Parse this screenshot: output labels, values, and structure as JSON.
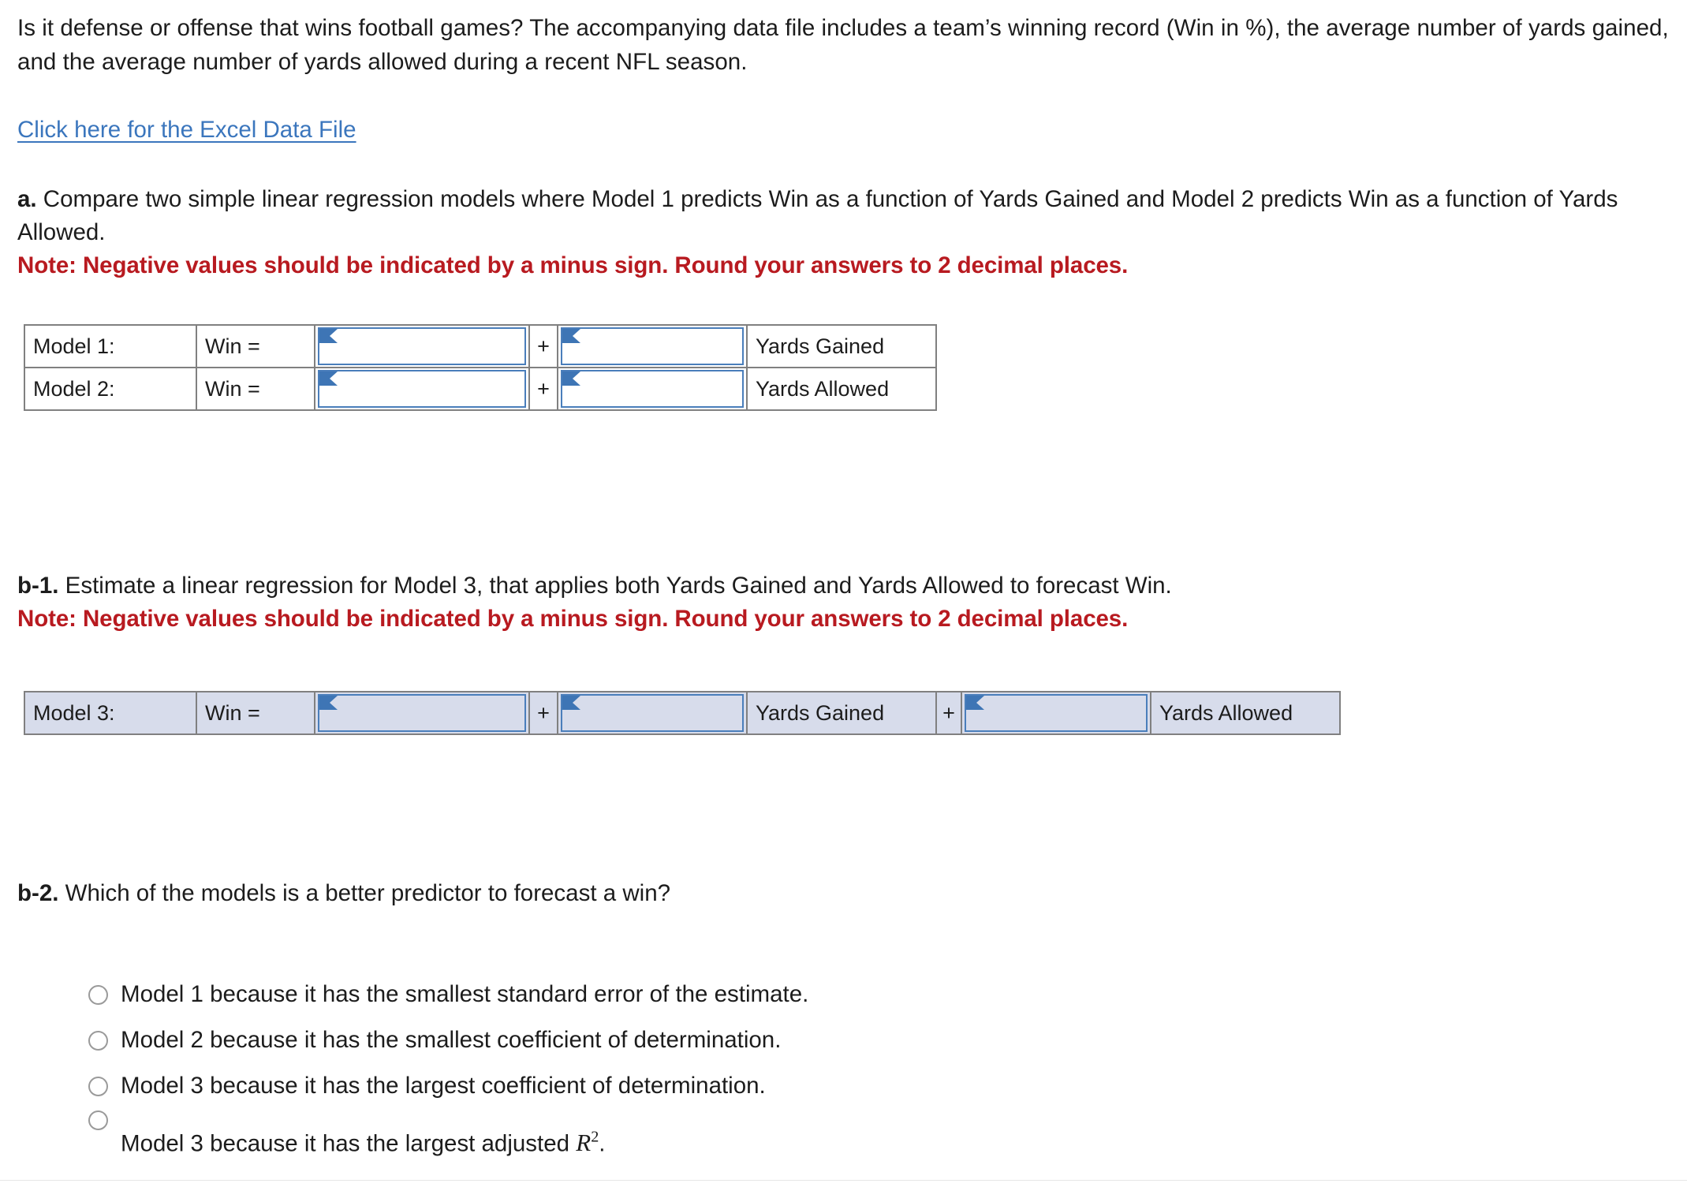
{
  "intro": {
    "paragraph": "Is it defense or offense that wins football games? The accompanying data file includes a team’s winning record (Win in %), the average number of yards gained, and the average number of yards allowed during a recent NFL season."
  },
  "link": {
    "label": "Click here for the Excel Data File"
  },
  "questions": {
    "a": {
      "label": "a.",
      "text": " Compare two simple linear regression models where Model 1 predicts Win as a function of Yards Gained and Model 2 predicts Win as a function of Yards Allowed.",
      "note": "Note: Negative values should be indicated by a minus sign. Round your answers to 2 decimal places."
    },
    "b1": {
      "label": "b-1.",
      "text": " Estimate a linear regression for Model 3, that applies both Yards Gained and Yards Allowed to forecast Win.",
      "note": "Note: Negative values should be indicated by a minus sign. Round your answers to 2 decimal places."
    },
    "b2": {
      "label": "b-2.",
      "text": " Which of the models is a better predictor to forecast a win?"
    }
  },
  "table_a": {
    "rows": [
      {
        "model": "Model 1:",
        "equals": "Win =",
        "intercept_value": "",
        "plus": "+",
        "slope_value": "",
        "variable": "Yards Gained"
      },
      {
        "model": "Model 2:",
        "equals": "Win =",
        "intercept_value": "",
        "plus": "+",
        "slope_value": "",
        "variable": "Yards Allowed"
      }
    ]
  },
  "table_b": {
    "row": {
      "model": "Model 3:",
      "equals": "Win =",
      "intercept_value": "",
      "plus1": "+",
      "slope1_value": "",
      "variable1": "Yards Gained",
      "plus2": "+",
      "slope2_value": "",
      "variable2": "Yards Allowed"
    }
  },
  "options": [
    {
      "text": "Model 1 because it has the smallest standard error of the estimate.",
      "selected": false
    },
    {
      "text": "Model 2 because it has the smallest coefficient of determination.",
      "selected": false
    },
    {
      "text": "Model 3 because it has the largest coefficient of determination.",
      "selected": false
    },
    {
      "text_prefix": "Model 3 because it has the largest adjusted ",
      "math": "R",
      "math_sup": "2",
      "text_suffix": ".",
      "selected": false
    }
  ],
  "colors": {
    "link": "#3b76bd",
    "note": "#b81a20",
    "input_border": "#4a7ebb",
    "table_border": "#808080",
    "highlight_bg": "#d7dceb"
  }
}
